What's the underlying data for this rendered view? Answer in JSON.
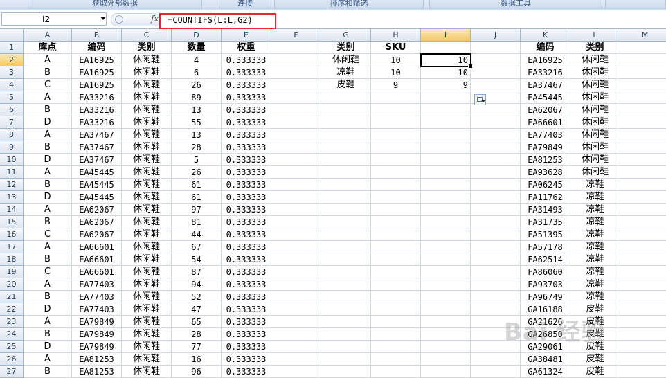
{
  "ribbon": {
    "groups": [
      "获取外部数据",
      "连接",
      "排序和筛选",
      "数据工具"
    ]
  },
  "formula_bar": {
    "name_box": "I2",
    "fx_label": "fx",
    "formula": "=COUNTIFS(L:L,G2)"
  },
  "columns": [
    "A",
    "B",
    "C",
    "D",
    "E",
    "F",
    "G",
    "H",
    "I",
    "J",
    "K",
    "L",
    "M"
  ],
  "selected": {
    "column": "I",
    "row": 2
  },
  "header_row": {
    "A": "库点",
    "B": "编码",
    "C": "类别",
    "D": "数量",
    "E": "权重",
    "G": "类别",
    "H": "SKU",
    "K": "编码",
    "L": "类别"
  },
  "rows": [
    {
      "num": "2",
      "A": "A",
      "B": "EA16925",
      "C": "休闲鞋",
      "D": "4",
      "E": "0.333333",
      "G": "休闲鞋",
      "H": "10",
      "I": "10",
      "K": "EA16925",
      "L": "休闲鞋"
    },
    {
      "num": "3",
      "A": "B",
      "B": "EA16925",
      "C": "休闲鞋",
      "D": "6",
      "E": "0.333333",
      "G": "凉鞋",
      "H": "10",
      "I": "10",
      "K": "EA33216",
      "L": "休闲鞋"
    },
    {
      "num": "4",
      "A": "C",
      "B": "EA16925",
      "C": "休闲鞋",
      "D": "26",
      "E": "0.333333",
      "G": "皮鞋",
      "H": "9",
      "I": "9",
      "K": "EA37467",
      "L": "休闲鞋"
    },
    {
      "num": "5",
      "A": "A",
      "B": "EA33216",
      "C": "休闲鞋",
      "D": "89",
      "E": "0.333333",
      "K": "EA45445",
      "L": "休闲鞋"
    },
    {
      "num": "6",
      "A": "B",
      "B": "EA33216",
      "C": "休闲鞋",
      "D": "13",
      "E": "0.333333",
      "K": "EA62067",
      "L": "休闲鞋"
    },
    {
      "num": "7",
      "A": "D",
      "B": "EA33216",
      "C": "休闲鞋",
      "D": "55",
      "E": "0.333333",
      "K": "EA66601",
      "L": "休闲鞋"
    },
    {
      "num": "8",
      "A": "A",
      "B": "EA37467",
      "C": "休闲鞋",
      "D": "13",
      "E": "0.333333",
      "K": "EA77403",
      "L": "休闲鞋"
    },
    {
      "num": "9",
      "A": "B",
      "B": "EA37467",
      "C": "休闲鞋",
      "D": "28",
      "E": "0.333333",
      "K": "EA79849",
      "L": "休闲鞋"
    },
    {
      "num": "10",
      "A": "D",
      "B": "EA37467",
      "C": "休闲鞋",
      "D": "5",
      "E": "0.333333",
      "K": "EA81253",
      "L": "休闲鞋"
    },
    {
      "num": "11",
      "A": "A",
      "B": "EA45445",
      "C": "休闲鞋",
      "D": "26",
      "E": "0.333333",
      "K": "EA93628",
      "L": "休闲鞋"
    },
    {
      "num": "12",
      "A": "B",
      "B": "EA45445",
      "C": "休闲鞋",
      "D": "61",
      "E": "0.333333",
      "K": "FA06245",
      "L": "凉鞋"
    },
    {
      "num": "13",
      "A": "D",
      "B": "EA45445",
      "C": "休闲鞋",
      "D": "61",
      "E": "0.333333",
      "K": "FA11762",
      "L": "凉鞋"
    },
    {
      "num": "14",
      "A": "A",
      "B": "EA62067",
      "C": "休闲鞋",
      "D": "97",
      "E": "0.333333",
      "K": "FA31493",
      "L": "凉鞋"
    },
    {
      "num": "15",
      "A": "B",
      "B": "EA62067",
      "C": "休闲鞋",
      "D": "81",
      "E": "0.333333",
      "K": "FA31735",
      "L": "凉鞋"
    },
    {
      "num": "16",
      "A": "C",
      "B": "EA62067",
      "C": "休闲鞋",
      "D": "44",
      "E": "0.333333",
      "K": "FA51395",
      "L": "凉鞋"
    },
    {
      "num": "17",
      "A": "A",
      "B": "EA66601",
      "C": "休闲鞋",
      "D": "67",
      "E": "0.333333",
      "K": "FA57178",
      "L": "凉鞋"
    },
    {
      "num": "18",
      "A": "B",
      "B": "EA66601",
      "C": "休闲鞋",
      "D": "54",
      "E": "0.333333",
      "K": "FA62514",
      "L": "凉鞋"
    },
    {
      "num": "19",
      "A": "C",
      "B": "EA66601",
      "C": "休闲鞋",
      "D": "87",
      "E": "0.333333",
      "K": "FA86060",
      "L": "凉鞋"
    },
    {
      "num": "20",
      "A": "A",
      "B": "EA77403",
      "C": "休闲鞋",
      "D": "94",
      "E": "0.333333",
      "K": "FA93703",
      "L": "凉鞋"
    },
    {
      "num": "21",
      "A": "B",
      "B": "EA77403",
      "C": "休闲鞋",
      "D": "52",
      "E": "0.333333",
      "K": "FA96749",
      "L": "凉鞋"
    },
    {
      "num": "22",
      "A": "D",
      "B": "EA77403",
      "C": "休闲鞋",
      "D": "47",
      "E": "0.333333",
      "K": "GA16188",
      "L": "皮鞋"
    },
    {
      "num": "23",
      "A": "A",
      "B": "EA79849",
      "C": "休闲鞋",
      "D": "65",
      "E": "0.333333",
      "K": "GA21626",
      "L": "皮鞋"
    },
    {
      "num": "24",
      "A": "B",
      "B": "EA79849",
      "C": "休闲鞋",
      "D": "28",
      "E": "0.333333",
      "K": "GA26850",
      "L": "皮鞋"
    },
    {
      "num": "25",
      "A": "D",
      "B": "EA79849",
      "C": "休闲鞋",
      "D": "77",
      "E": "0.333333",
      "K": "GA29061",
      "L": "皮鞋"
    },
    {
      "num": "26",
      "A": "A",
      "B": "EA81253",
      "C": "休闲鞋",
      "D": "16",
      "E": "0.333333",
      "K": "GA38481",
      "L": "皮鞋"
    },
    {
      "num": "27",
      "A": "B",
      "B": "EA81253",
      "C": "休闲鞋",
      "D": "96",
      "E": "0.333333",
      "K": "GA61324",
      "L": "皮鞋"
    }
  ],
  "watermark": "Bai 经验"
}
